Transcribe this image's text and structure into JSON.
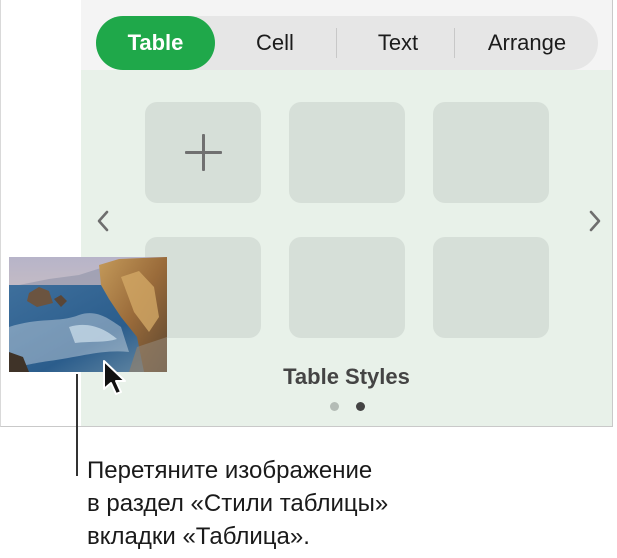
{
  "tabs": [
    {
      "label": "Table",
      "active": true
    },
    {
      "label": "Cell",
      "active": false
    },
    {
      "label": "Text",
      "active": false
    },
    {
      "label": "Arrange",
      "active": false
    }
  ],
  "panel": {
    "section_label": "Table Styles",
    "page_indicator": {
      "pages": 2,
      "current": 2
    },
    "tiles_count": 6,
    "add_tile_icon": "plus-icon",
    "nav_prev_icon": "chevron-left-icon",
    "nav_next_icon": "chevron-right-icon"
  },
  "drag": {
    "image_description_icon": "photo-thumbnail",
    "cursor_icon": "arrow-cursor-icon"
  },
  "caption": {
    "line1": "Перетяните изображение",
    "line2": "в раздел «Стили таблицы»",
    "line3": "вкладки «Таблица»."
  },
  "colors": {
    "accent": "#1fa84a",
    "panel_bg": "#e8f1e9",
    "tile_bg": "#d6dfd8"
  }
}
